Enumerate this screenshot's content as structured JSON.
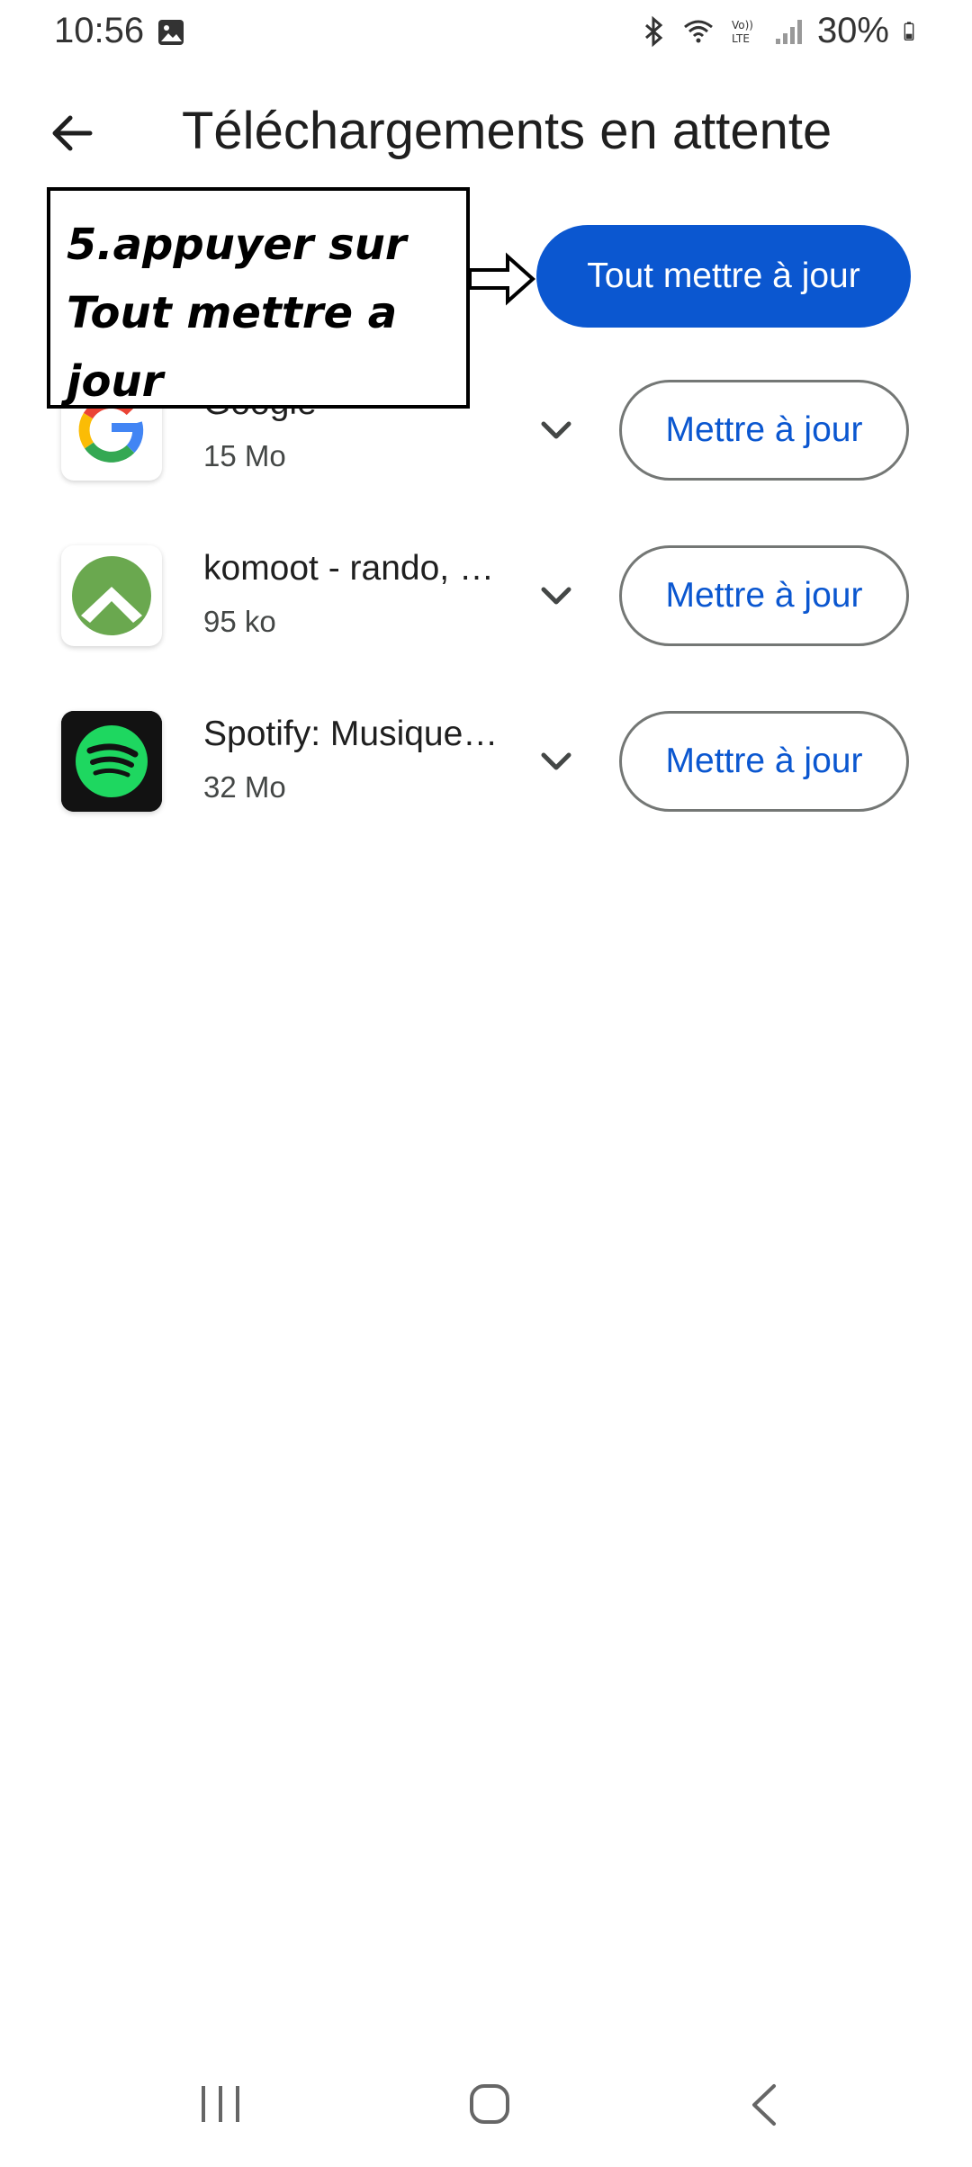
{
  "status_bar": {
    "time": "10:56",
    "battery": "30%",
    "icons": [
      "gallery-icon",
      "bluetooth-icon",
      "wifi-icon",
      "volte-icon",
      "signal-icon",
      "battery-icon"
    ]
  },
  "header": {
    "title": "Téléchargements en attente",
    "back_icon": "arrow-left-icon"
  },
  "update_all_label": "Tout mettre à jour",
  "annotation": {
    "line1": "5.appuyer sur",
    "line2": "Tout mettre a jour"
  },
  "apps": [
    {
      "name": "Google",
      "size": "15 Mo",
      "button": "Mettre à jour",
      "icon": "google-icon"
    },
    {
      "name": "komoot - rando, …",
      "size": "95 ko",
      "button": "Mettre à jour",
      "icon": "komoot-icon"
    },
    {
      "name": "Spotify: Musique…",
      "size": "32 Mo",
      "button": "Mettre à jour",
      "icon": "spotify-icon"
    }
  ],
  "colors": {
    "primary": "#0b57d0",
    "outline": "#747775",
    "text": "#1f1f1f",
    "secondary_text": "#444746",
    "spotify_green": "#1ed760",
    "komoot_green": "#6aa84f"
  },
  "nav_bar": [
    "recents-icon",
    "home-icon",
    "back-icon"
  ]
}
